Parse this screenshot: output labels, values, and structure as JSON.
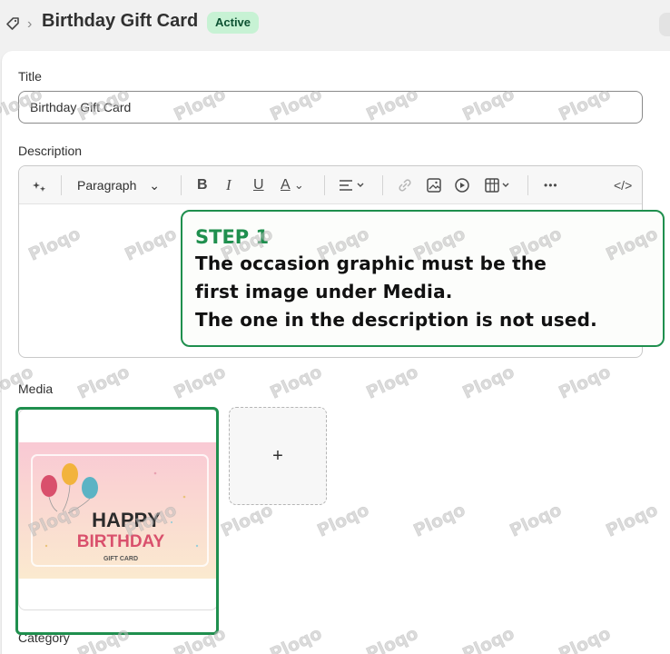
{
  "header": {
    "title": "Birthday Gift Card",
    "status": "Active",
    "breadcrumb_separator": "›"
  },
  "form": {
    "title_label": "Title",
    "title_value": "Birthday Gift Card",
    "description_label": "Description",
    "toolbar": {
      "block_type": "Paragraph",
      "bold": "B",
      "italic": "I",
      "underline": "U",
      "text_color": "A",
      "more": "•••",
      "code": "</>"
    },
    "media_label": "Media",
    "add_media": "+",
    "category_label": "Category"
  },
  "gift_card_image": {
    "line1": "HAPPY",
    "line2": "BIRTHDAY",
    "line3": "GIFT CARD"
  },
  "annotation": {
    "heading": "STEP 1",
    "lines": [
      "The occasion graphic must be the",
      "first image under Media.",
      "The one in the description is not used."
    ]
  },
  "watermark": "Ploqo",
  "colors": {
    "annotation_green": "#1f8f4e",
    "badge_bg": "#c7f2d4",
    "badge_text": "#0c5132"
  }
}
